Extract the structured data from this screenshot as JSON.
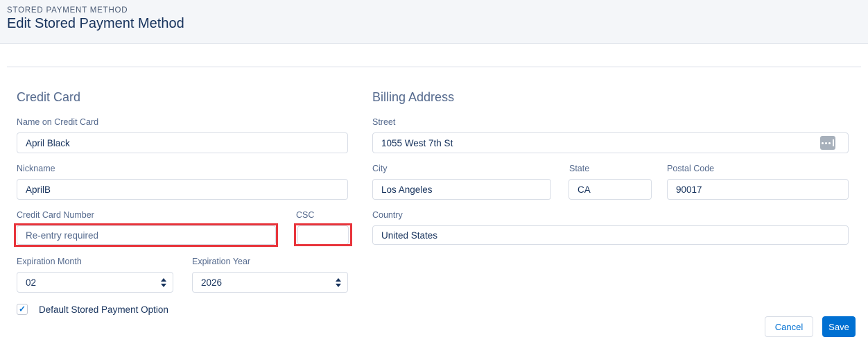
{
  "header": {
    "eyebrow": "STORED PAYMENT METHOD",
    "title": "Edit Stored Payment Method"
  },
  "sections": {
    "credit_card": {
      "heading": "Credit Card",
      "fields": {
        "name_on_card": {
          "label": "Name on Credit Card",
          "value": "April Black"
        },
        "nickname": {
          "label": "Nickname",
          "value": "AprilB"
        },
        "credit_card_number": {
          "label": "Credit Card Number",
          "placeholder": "Re-entry required",
          "value": ""
        },
        "csc": {
          "label": "CSC",
          "value": ""
        },
        "expiration_month": {
          "label": "Expiration Month",
          "value": "02"
        },
        "expiration_year": {
          "label": "Expiration Year",
          "value": "2026"
        },
        "default_option": {
          "label": "Default Stored Payment Option",
          "checked": true
        }
      }
    },
    "billing_address": {
      "heading": "Billing Address",
      "fields": {
        "street": {
          "label": "Street",
          "value": "1055 West 7th St"
        },
        "city": {
          "label": "City",
          "value": "Los Angeles"
        },
        "state": {
          "label": "State",
          "value": "CA"
        },
        "postal_code": {
          "label": "Postal Code",
          "value": "90017"
        },
        "country": {
          "label": "Country",
          "value": "United States"
        }
      }
    }
  },
  "footer": {
    "cancel_label": "Cancel",
    "save_label": "Save"
  },
  "icons": {
    "check_glyph": "✓"
  },
  "colors": {
    "accent": "#0070d2",
    "highlight_red": "#e8353c",
    "label": "#54698d",
    "text": "#16325c",
    "border": "#d8dde6",
    "header_bg": "#f4f6f9"
  }
}
